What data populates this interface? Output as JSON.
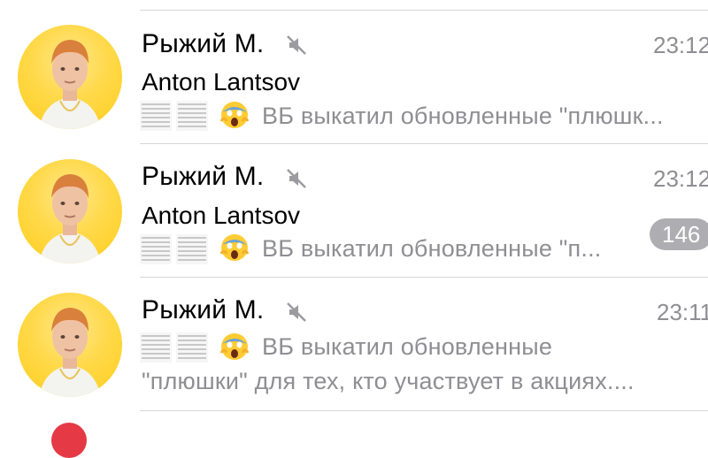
{
  "chats": [
    {
      "title": "Рыжий М.",
      "muted_icon": "muted-bell-icon",
      "time": "23:12",
      "sender": "Anton Lantsov",
      "preview": [
        "ВБ выкатил обновленные \"плюшк..."
      ],
      "badge": ""
    },
    {
      "title": "Рыжий М.",
      "muted_icon": "muted-bell-icon",
      "time": "23:12",
      "sender": "Anton Lantsov",
      "preview": [
        "ВБ выкатил обновленные \"п..."
      ],
      "badge": "146"
    },
    {
      "title": "Рыжий М.",
      "muted_icon": "muted-bell-icon",
      "time": "23:11",
      "sender": "",
      "preview": [
        "ВБ выкатил обновленные",
        "\"плюшки\" для тех, кто участвует в акциях...."
      ],
      "badge": ""
    }
  ],
  "colors": {
    "avatar_bg": "#ffd94a",
    "secondary_text": "#8e8e93",
    "badge_bg": "#aeaeb2",
    "next_avatar": "#e53945"
  }
}
